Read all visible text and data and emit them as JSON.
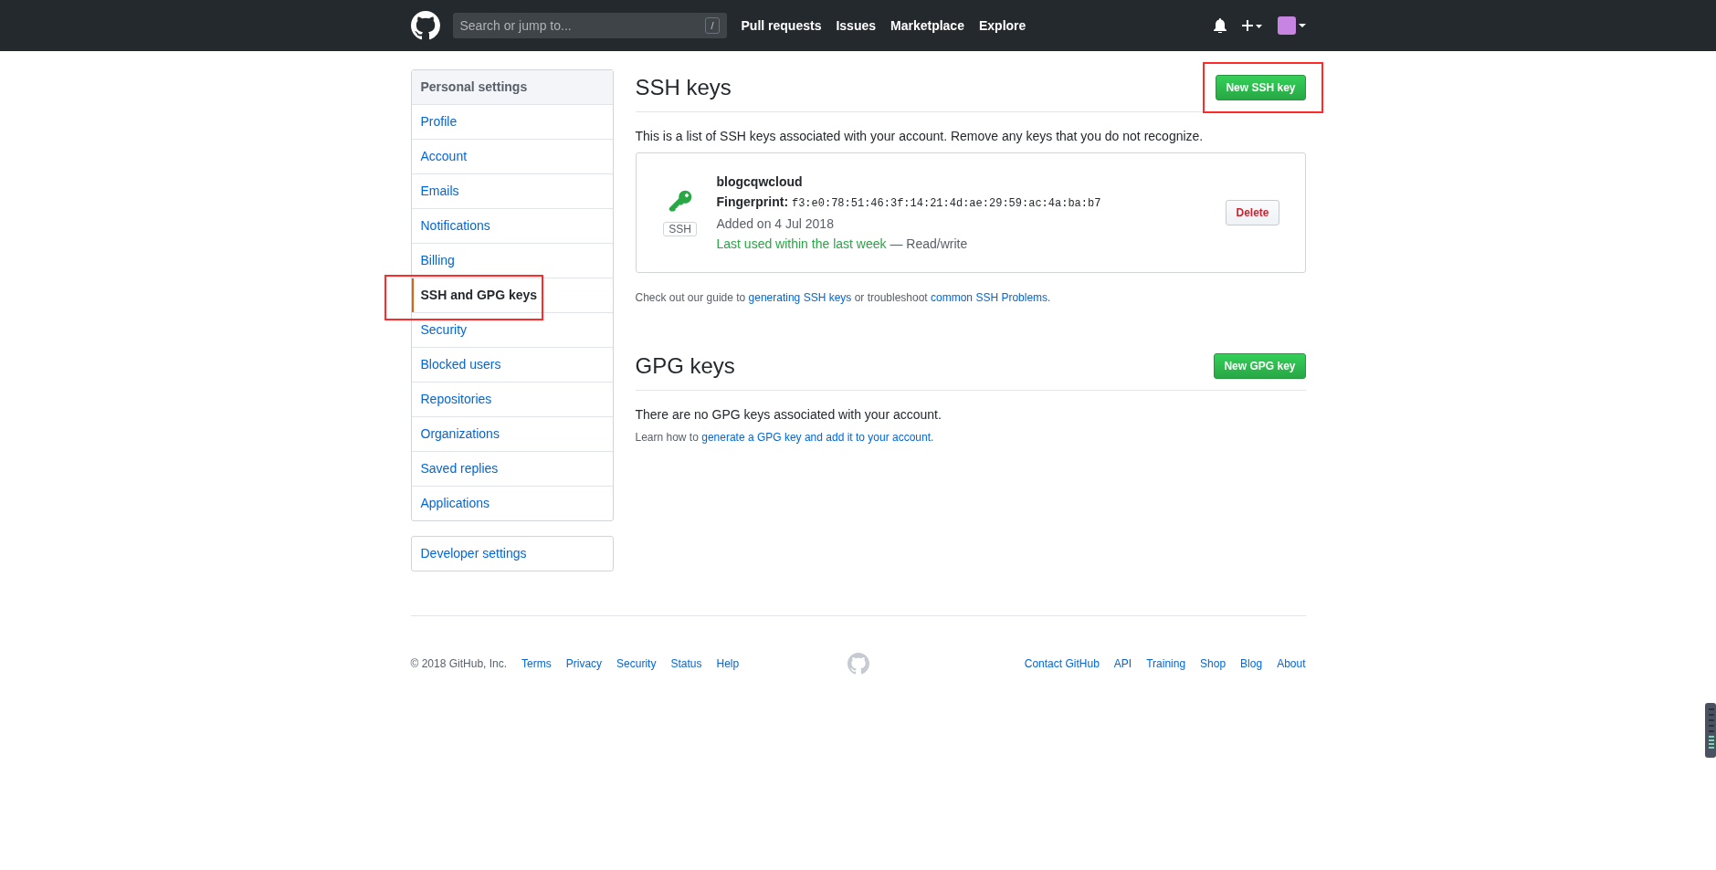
{
  "header": {
    "search": {
      "placeholder": "Search or jump to...",
      "shortcut": "/"
    },
    "nav": [
      "Pull requests",
      "Issues",
      "Marketplace",
      "Explore"
    ]
  },
  "sidebar": {
    "title": "Personal settings",
    "items": [
      {
        "label": "Profile",
        "selected": false,
        "annotated": false
      },
      {
        "label": "Account",
        "selected": false,
        "annotated": false
      },
      {
        "label": "Emails",
        "selected": false,
        "annotated": false
      },
      {
        "label": "Notifications",
        "selected": false,
        "annotated": false
      },
      {
        "label": "Billing",
        "selected": false,
        "annotated": false
      },
      {
        "label": "SSH and GPG keys",
        "selected": true,
        "annotated": true
      },
      {
        "label": "Security",
        "selected": false,
        "annotated": false
      },
      {
        "label": "Blocked users",
        "selected": false,
        "annotated": false
      },
      {
        "label": "Repositories",
        "selected": false,
        "annotated": false
      },
      {
        "label": "Organizations",
        "selected": false,
        "annotated": false
      },
      {
        "label": "Saved replies",
        "selected": false,
        "annotated": false
      },
      {
        "label": "Applications",
        "selected": false,
        "annotated": false
      }
    ],
    "developer": "Developer settings"
  },
  "ssh": {
    "title": "SSH keys",
    "button": {
      "label": "New SSH key",
      "annotated": true
    },
    "intro": "This is a list of SSH keys associated with your account. Remove any keys that you do not recognize.",
    "keys": [
      {
        "name": "blogcqwcloud",
        "badge": "SSH",
        "fingerprint_label": "Fingerprint:",
        "fingerprint": "f3:e0:78:51:46:3f:14:21:4d:ae:29:59:ac:4a:ba:b7",
        "added": "Added on 4 Jul 2018",
        "last_used": "Last used within the last week",
        "access": "— Read/write",
        "delete": "Delete"
      }
    ],
    "guide": [
      {
        "kind": "text",
        "text": "Check out our guide to "
      },
      {
        "kind": "link",
        "text": "generating SSH keys"
      },
      {
        "kind": "text",
        "text": " or troubleshoot "
      },
      {
        "kind": "link",
        "text": "common SSH Problems"
      },
      {
        "kind": "text",
        "text": "."
      }
    ]
  },
  "gpg": {
    "title": "GPG keys",
    "button": {
      "label": "New GPG key",
      "annotated": false
    },
    "empty": "There are no GPG keys associated with your account.",
    "guide": [
      {
        "kind": "text",
        "text": "Learn how to "
      },
      {
        "kind": "link",
        "text": "generate a GPG key and add it to your account"
      },
      {
        "kind": "text",
        "text": "."
      }
    ]
  },
  "footer": {
    "copyright": "© 2018 GitHub, Inc.",
    "left_links": [
      "Terms",
      "Privacy",
      "Security",
      "Status",
      "Help"
    ],
    "right_links": [
      "Contact GitHub",
      "API",
      "Training",
      "Shop",
      "Blog",
      "About"
    ]
  }
}
